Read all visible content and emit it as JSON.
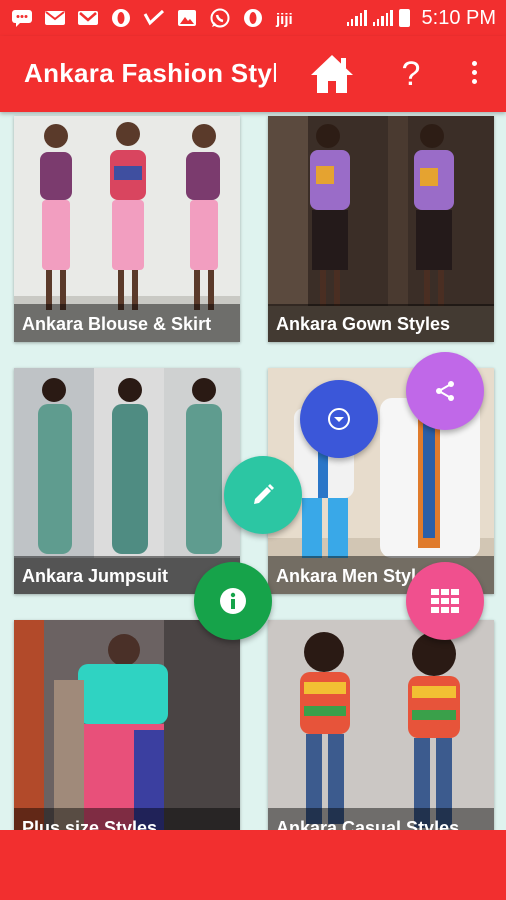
{
  "status_bar": {
    "time": "5:10 PM",
    "icons": [
      "message-icon",
      "email-icon",
      "gmail-icon",
      "opera-icon",
      "check-icon",
      "gallery-icon",
      "whatsapp-icon",
      "opera-icon",
      "jiji-icon"
    ]
  },
  "app_bar": {
    "title": "Ankara Fashion Styles",
    "actions": [
      "home-icon",
      "help-icon",
      "more-vert-icon"
    ],
    "help_label": "?"
  },
  "categories": [
    {
      "title": "Ankara Blouse & Skirt"
    },
    {
      "title": "Ankara Gown Styles"
    },
    {
      "title": "Ankara Jumpsuit"
    },
    {
      "title": "Ankara Men Styles"
    },
    {
      "title": "Plus size Styles"
    },
    {
      "title": "Ankara Casual Styles"
    }
  ],
  "fabs": [
    {
      "name": "share-fab",
      "icon": "share-icon",
      "color": "#c068e8"
    },
    {
      "name": "dropdown-fab",
      "icon": "dropdown-circle-icon",
      "color": "#3b57d9"
    },
    {
      "name": "edit-fab",
      "icon": "pencil-icon",
      "color": "#2cc6a3"
    },
    {
      "name": "info-fab",
      "icon": "info-icon",
      "color": "#16a34a"
    },
    {
      "name": "apps-fab",
      "icon": "grid-icon",
      "color": "#f0508e"
    }
  ],
  "colors": {
    "primary": "#f22f2f",
    "background": "#dff3ef"
  }
}
